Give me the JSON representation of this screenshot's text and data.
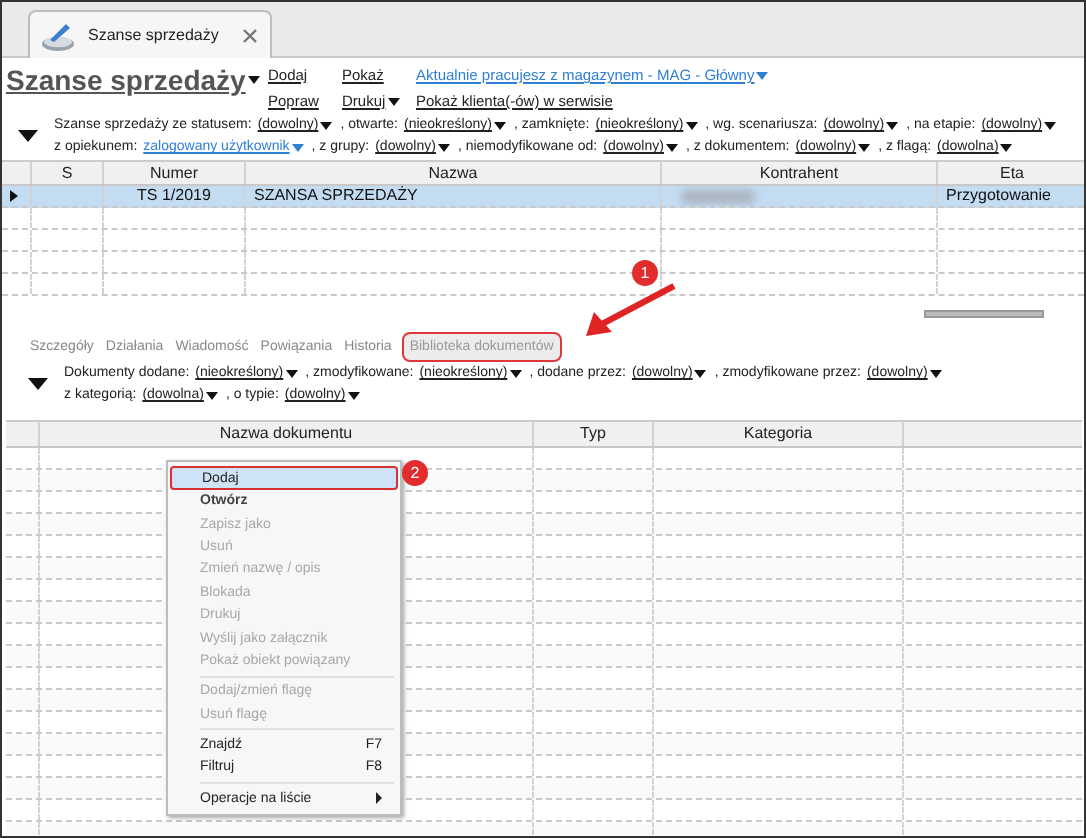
{
  "window_tab": {
    "title": "Szanse sprzedaży",
    "closable": true
  },
  "header": {
    "title": "Szanse sprzedaży",
    "actions": [
      {
        "label": "Dodaj",
        "kind": "link"
      },
      {
        "label": "Popraw",
        "kind": "link"
      },
      {
        "label": "Pokaż",
        "kind": "link"
      },
      {
        "label": "Drukuj",
        "kind": "menu"
      }
    ],
    "info_links": [
      {
        "label": "Aktualnie pracujesz z magazynem - MAG - Główny",
        "dropdown": true
      },
      {
        "label": "Pokaż klienta(-ów) w serwisie",
        "dropdown": false
      }
    ]
  },
  "filters": [
    [
      {
        "label": "Szanse sprzedaży ze statusem:",
        "value": "(dowolny)",
        "kind": "plain"
      },
      {
        "label": ", otwarte:",
        "value": "(nieokreślony)",
        "kind": "plain"
      },
      {
        "label": ", zamknięte:",
        "value": "(nieokreślony)",
        "kind": "plain"
      },
      {
        "label": ", wg. scenariusza:",
        "value": "(dowolny)",
        "kind": "plain"
      },
      {
        "label": ", na etapie:",
        "value": "(dowolny)",
        "kind": "plain"
      }
    ],
    [
      {
        "label": "z opiekunem:",
        "value": "zalogowany użytkownik",
        "kind": "link"
      },
      {
        "label": ", z grupy:",
        "value": "(dowolny)",
        "kind": "plain"
      },
      {
        "label": ", niemodyfikowane od:",
        "value": "(dowolny)",
        "kind": "plain"
      },
      {
        "label": ", z dokumentem:",
        "value": "(dowolny)",
        "kind": "plain"
      },
      {
        "label": ", z flagą:",
        "value": "(dowolna)",
        "kind": "plain"
      }
    ]
  ],
  "table": {
    "columns": [
      "S",
      "Numer",
      "Nazwa",
      "Kontrahent",
      "Eta"
    ],
    "rows": [
      {
        "selected": true,
        "cells": [
          "",
          "TS 1/2019",
          "SZANSA SPRZEDAŻY",
          "",
          "Przygotowanie"
        ],
        "contractor_redacted": true
      }
    ]
  },
  "detail_tabs": [
    {
      "label": "Szczegóły",
      "selected": false
    },
    {
      "label": "Działania",
      "selected": false
    },
    {
      "label": "Wiadomość",
      "selected": false
    },
    {
      "label": "Powiązania",
      "selected": false
    },
    {
      "label": "Historia",
      "selected": false
    },
    {
      "label": "Biblioteka dokumentów",
      "selected": true
    }
  ],
  "document_filters": [
    [
      {
        "label": "Dokumenty dodane:",
        "value": "(nieokreślony)",
        "kind": "plain"
      },
      {
        "label": ", zmodyfikowane:",
        "value": "(nieokreślony)",
        "kind": "plain"
      },
      {
        "label": ", dodane przez:",
        "value": "(dowolny)",
        "kind": "plain"
      },
      {
        "label": ", zmodyfikowane przez:",
        "value": "(dowolny)",
        "kind": "plain"
      }
    ],
    [
      {
        "label": "z kategorią:",
        "value": "(dowolna)",
        "kind": "plain"
      },
      {
        "label": ", o typie:",
        "value": "(dowolny)",
        "kind": "plain"
      }
    ]
  ],
  "document_table": {
    "columns": [
      "Nazwa dokumentu",
      "Typ",
      "Kategoria"
    ]
  },
  "context_menu": [
    {
      "kind": "item",
      "label": "Dodaj",
      "selected": true,
      "disabled": false,
      "default": false
    },
    {
      "kind": "item",
      "label": "Otwórz",
      "selected": false,
      "disabled": false,
      "default": true
    },
    {
      "kind": "item",
      "label": "Zapisz jako",
      "selected": false,
      "disabled": true,
      "default": false
    },
    {
      "kind": "item",
      "label": "Usuń",
      "selected": false,
      "disabled": true,
      "default": false
    },
    {
      "kind": "item",
      "label": "Zmień nazwę / opis",
      "selected": false,
      "disabled": true,
      "default": false
    },
    {
      "kind": "item",
      "label": "Blokada",
      "selected": false,
      "disabled": true,
      "default": false
    },
    {
      "kind": "item",
      "label": "Drukuj",
      "selected": false,
      "disabled": true,
      "default": false
    },
    {
      "kind": "item",
      "label": "Wyślij jako załącznik",
      "selected": false,
      "disabled": true,
      "default": false
    },
    {
      "kind": "item",
      "label": "Pokaż obiekt powiązany",
      "selected": false,
      "disabled": true,
      "default": false
    },
    {
      "kind": "separator"
    },
    {
      "kind": "item",
      "label": "Dodaj/zmień flagę",
      "selected": false,
      "disabled": true,
      "default": false
    },
    {
      "kind": "item",
      "label": "Usuń flagę",
      "selected": false,
      "disabled": true,
      "default": false
    },
    {
      "kind": "separator"
    },
    {
      "kind": "item",
      "label": "Znajdź",
      "shortcut": "F7",
      "selected": false,
      "disabled": false,
      "default": false
    },
    {
      "kind": "item",
      "label": "Filtruj",
      "shortcut": "F8",
      "selected": false,
      "disabled": false,
      "default": false
    },
    {
      "kind": "separator"
    },
    {
      "kind": "submenu",
      "label": "Operacje na liście",
      "selected": false,
      "disabled": false,
      "default": false
    }
  ],
  "annotations": [
    {
      "label": "1"
    },
    {
      "label": "2"
    }
  ]
}
